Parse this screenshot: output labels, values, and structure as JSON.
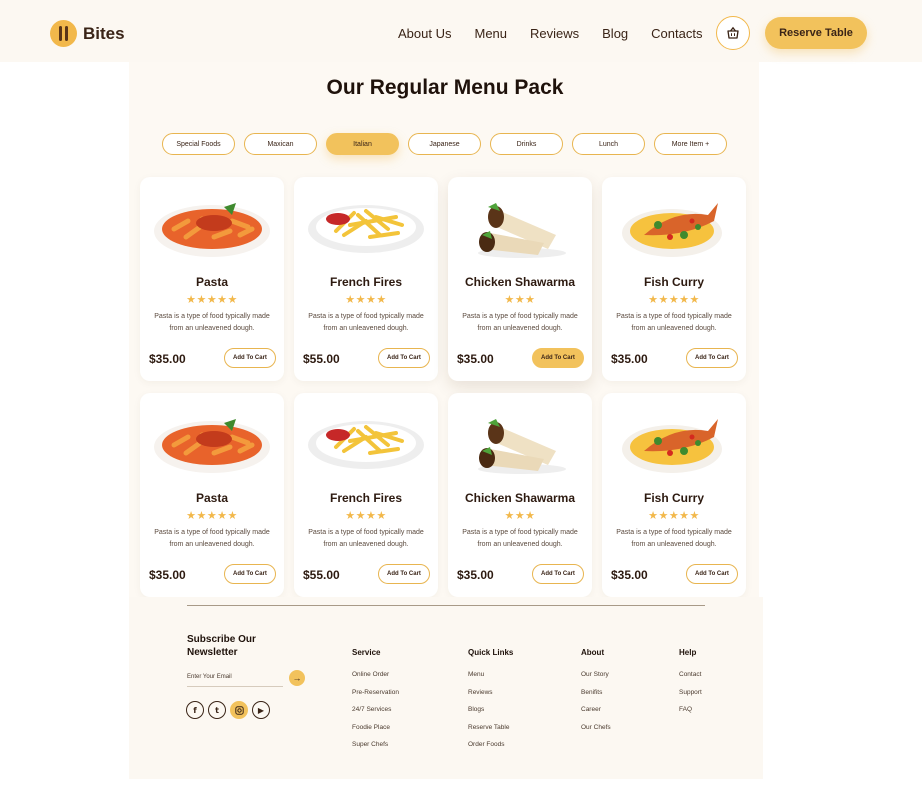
{
  "header": {
    "brand": "Bites",
    "nav": [
      "About Us",
      "Menu",
      "Reviews",
      "Blog",
      "Contacts"
    ],
    "reserve_label": "Reserve Table"
  },
  "main": {
    "title": "Our Regular Menu Pack",
    "tabs": [
      {
        "label": "Special Foods",
        "active": false
      },
      {
        "label": "Maxican",
        "active": false
      },
      {
        "label": "Italian",
        "active": true
      },
      {
        "label": "Japanese",
        "active": false
      },
      {
        "label": "Drinks",
        "active": false
      },
      {
        "label": "Lunch",
        "active": false
      },
      {
        "label": "More Item +",
        "active": false
      }
    ],
    "cards": [
      {
        "name": "Pasta",
        "rating": 5,
        "stars": "★★★★★",
        "desc": "Pasta is a type of food typically made from an unleavened dough.",
        "price": "$35.00",
        "button": "Add To Cart",
        "food": "pasta",
        "selected": false
      },
      {
        "name": "French Fires",
        "rating": 4,
        "stars": "★★★★",
        "desc": "Pasta is a type of food typically made from an unleavened dough.",
        "price": "$55.00",
        "button": "Add To Cart",
        "food": "fries",
        "selected": false
      },
      {
        "name": "Chicken Shawarma",
        "rating": 3,
        "stars": "★★★",
        "desc": "Pasta is a type of food typically made from an unleavened dough.",
        "price": "$35.00",
        "button": "Add To Cart",
        "food": "shawarma",
        "selected": true
      },
      {
        "name": "Fish Curry",
        "rating": 5,
        "stars": "★★★★★",
        "desc": "Pasta is a type of food typically made from an unleavened dough.",
        "price": "$35.00",
        "button": "Add To Cart",
        "food": "fish",
        "selected": false
      },
      {
        "name": "Pasta",
        "rating": 5,
        "stars": "★★★★★",
        "desc": "Pasta is a type of food typically made from an unleavened dough.",
        "price": "$35.00",
        "button": "Add To Cart",
        "food": "pasta",
        "selected": false
      },
      {
        "name": "French Fires",
        "rating": 4,
        "stars": "★★★★",
        "desc": "Pasta is a type of food typically made from an unleavened dough.",
        "price": "$55.00",
        "button": "Add To Cart",
        "food": "fries",
        "selected": false
      },
      {
        "name": "Chicken Shawarma",
        "rating": 3,
        "stars": "★★★",
        "desc": "Pasta is a type of food typically made from an unleavened dough.",
        "price": "$35.00",
        "button": "Add To Cart",
        "food": "shawarma",
        "selected": false
      },
      {
        "name": "Fish Curry",
        "rating": 5,
        "stars": "★★★★★",
        "desc": "Pasta is a type of food typically made from an unleavened dough.",
        "price": "$35.00",
        "button": "Add To Cart",
        "food": "fish",
        "selected": false
      }
    ]
  },
  "footer": {
    "newsletter_title": "Subscribe Our Newsletter",
    "email_placeholder": "Enter Your Email",
    "socials": [
      "facebook-icon",
      "twitter-icon",
      "instagram-icon",
      "youtube-icon"
    ],
    "columns": [
      {
        "title": "Service",
        "links": [
          "Online Order",
          "Pre-Reservation",
          "24/7 Services",
          "Foodie Place",
          "Super Chefs"
        ]
      },
      {
        "title": "Quick Links",
        "links": [
          "Menu",
          "Reviews",
          "Blogs",
          "Reserve Table",
          "Order Foods"
        ]
      },
      {
        "title": "About",
        "links": [
          "Our Story",
          "Benifits",
          "Career",
          "Our Chefs"
        ]
      },
      {
        "title": "Help",
        "links": [
          "Contact",
          "Support",
          "FAQ"
        ]
      }
    ]
  },
  "colors": {
    "accent": "#f2c25c",
    "text": "#3a2417",
    "background": "#fdf9f3"
  }
}
